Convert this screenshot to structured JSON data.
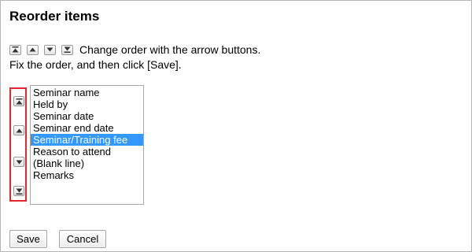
{
  "page": {
    "title": "Reorder items"
  },
  "instructions": {
    "line1": "Change order with the arrow buttons.",
    "line2": "Fix the order, and then click [Save].",
    "icons": [
      "move-to-top-icon",
      "move-up-icon",
      "move-down-icon",
      "move-to-bottom-icon"
    ]
  },
  "arrow_controls": [
    {
      "name": "move-to-top-button",
      "icon": "move-to-top-icon"
    },
    {
      "name": "move-up-button",
      "icon": "move-up-icon"
    },
    {
      "name": "move-down-button",
      "icon": "move-down-icon"
    },
    {
      "name": "move-to-bottom-button",
      "icon": "move-to-bottom-icon"
    }
  ],
  "list": {
    "items": [
      "Seminar name",
      "Held by",
      "Seminar date",
      "Seminar end date",
      "Seminar/Training fee",
      "Reason to attend",
      "(Blank line)",
      "Remarks"
    ],
    "selected_index": 4
  },
  "actions": {
    "save_label": "Save",
    "cancel_label": "Cancel"
  },
  "colors": {
    "highlight_border": "#e8262b",
    "selection_background": "#3399ff"
  }
}
